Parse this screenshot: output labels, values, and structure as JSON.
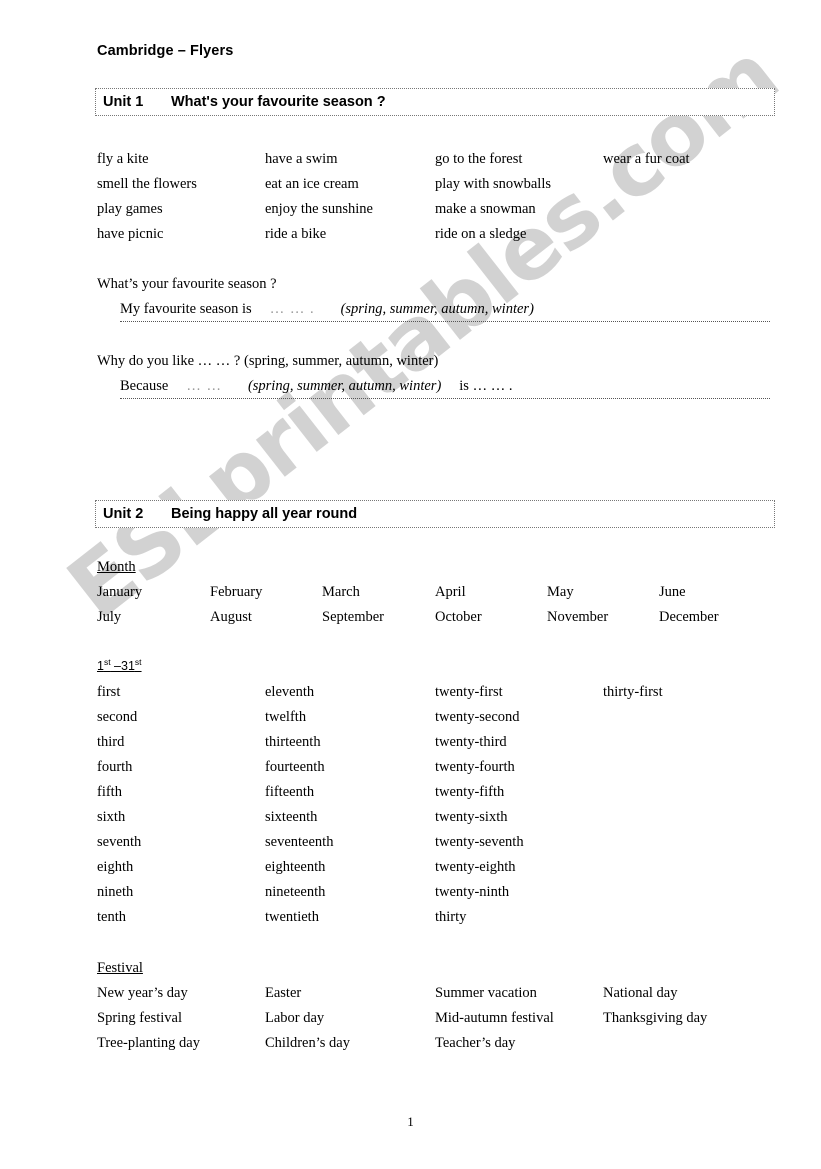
{
  "document": {
    "title": "Cambridge – Flyers",
    "page_number": "1",
    "watermark": "ESLprintables.com"
  },
  "unit1": {
    "label": "Unit 1",
    "title": "What's your favourite season ?",
    "vocabulary_columns": [
      [
        "fly a kite",
        "smell the flowers",
        "play games",
        "have picnic"
      ],
      [
        "have a swim",
        "eat an ice cream",
        "enjoy the sunshine",
        "ride a bike"
      ],
      [
        "go to the forest",
        "play with snowballs",
        "make a snowman",
        "ride on a sledge"
      ],
      [
        "wear a fur coat"
      ]
    ],
    "qa": [
      {
        "question": "What’s your favourite season ?",
        "answer_prefix": "My favourite season is",
        "answer_dots": "… … .",
        "answer_italic": "(spring, summer, autumn, winter)",
        "answer_suffix": ""
      },
      {
        "question": "Why do you like … … ? (spring, summer, autumn, winter)",
        "answer_prefix": "Because",
        "answer_dots": "… …",
        "answer_italic": "(spring, summer, autumn, winter)",
        "answer_suffix": "is … … ."
      }
    ]
  },
  "unit2": {
    "label": "Unit 2",
    "title": "Being happy all year round",
    "month_heading": "Month",
    "months": [
      [
        "January",
        "February",
        "March",
        "April",
        "May",
        "June"
      ],
      [
        "July",
        "August",
        "September",
        "October",
        "November",
        "December"
      ]
    ],
    "ordinal_heading_prefix": "1",
    "ordinal_heading_sup1": "st",
    "ordinal_heading_middle": " –31",
    "ordinal_heading_sup2": "st",
    "ordinals_columns": [
      [
        "first",
        "second",
        "third",
        "fourth",
        "fifth",
        "sixth",
        "seventh",
        "eighth",
        "nineth",
        "tenth"
      ],
      [
        "eleventh",
        "twelfth",
        "thirteenth",
        "fourteenth",
        "fifteenth",
        "sixteenth",
        "seventeenth",
        "eighteenth",
        "nineteenth",
        "twentieth"
      ],
      [
        "twenty-first",
        "twenty-second",
        "twenty-third",
        "twenty-fourth",
        "twenty-fifth",
        "twenty-sixth",
        "twenty-seventh",
        "twenty-eighth",
        "twenty-ninth",
        "thirty"
      ],
      [
        "thirty-first"
      ]
    ],
    "festival_heading": "Festival",
    "festivals_columns": [
      [
        "New year’s day",
        "Spring festival",
        "Tree-planting day"
      ],
      [
        "Easter",
        "Labor day",
        "Children’s day"
      ],
      [
        "Summer vacation",
        "Mid-autumn festival",
        "Teacher’s day"
      ],
      [
        "National day",
        "Thanksgiving day"
      ]
    ]
  }
}
